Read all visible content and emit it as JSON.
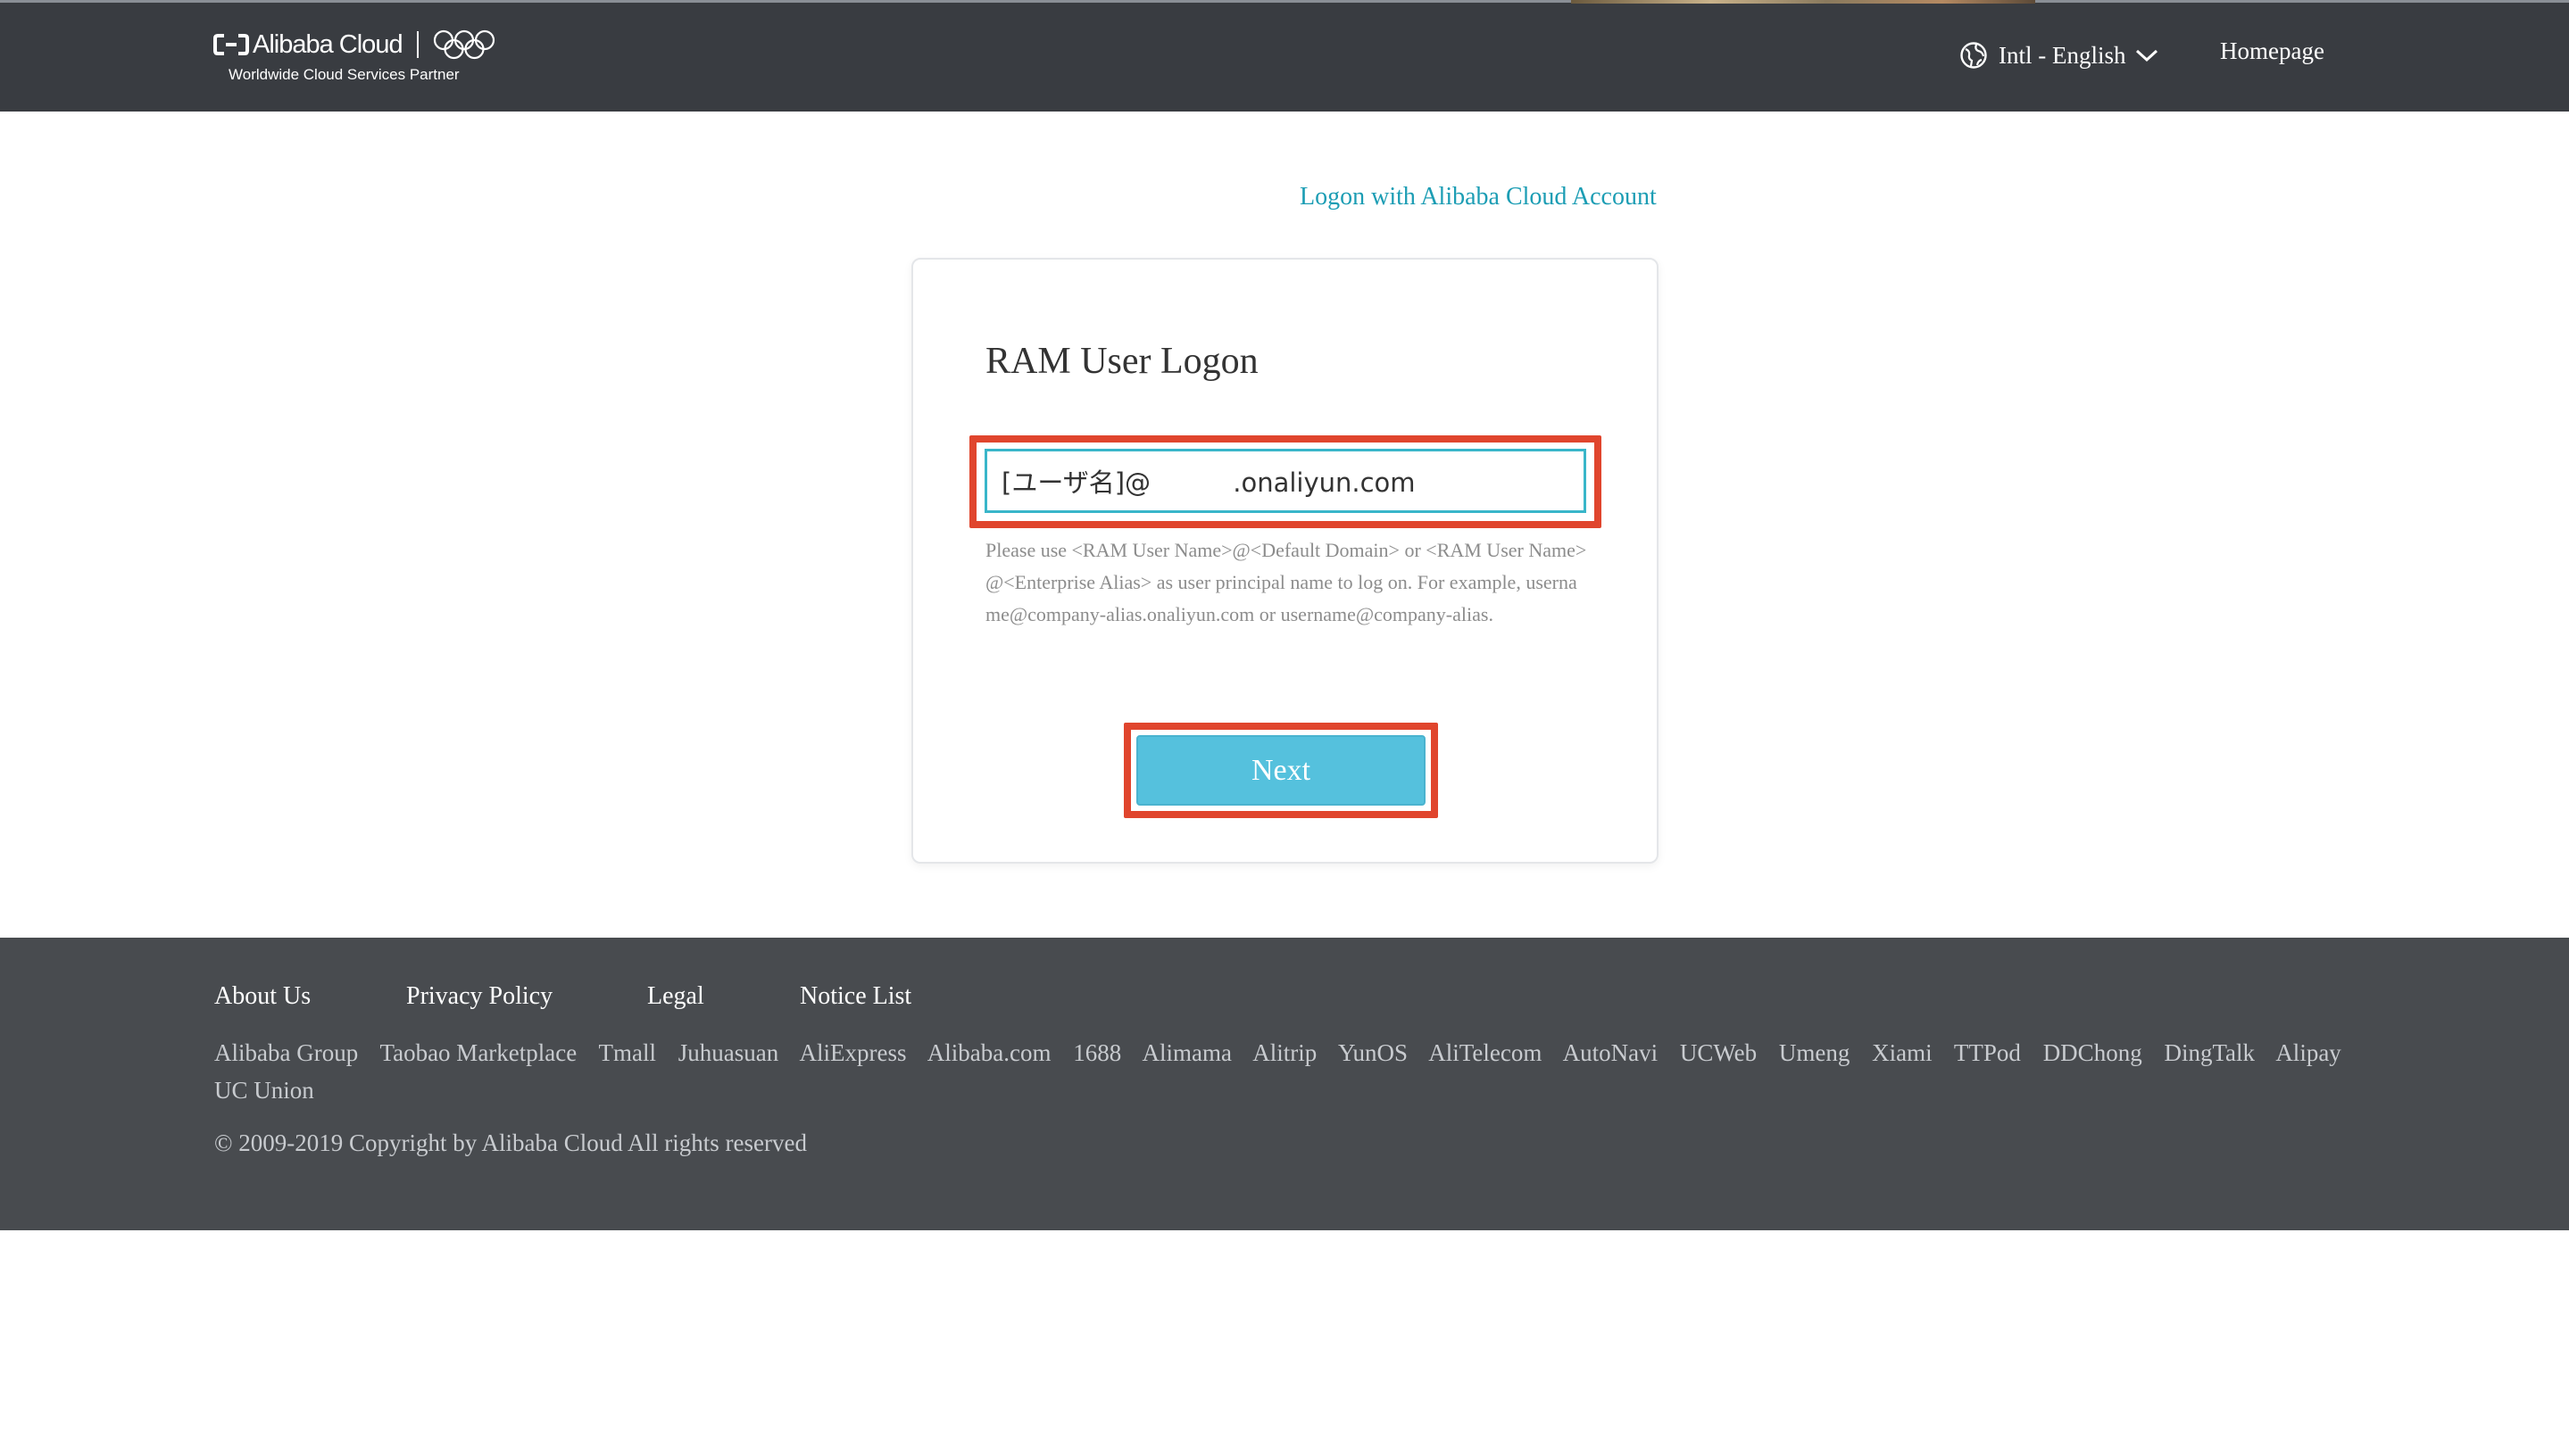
{
  "header": {
    "brand_name": "Alibaba Cloud",
    "tagline": "Worldwide Cloud Services Partner",
    "language": "Intl - English",
    "homepage_label": "Homepage"
  },
  "main": {
    "account_link": "Logon with Alibaba Cloud Account",
    "title": "RAM User Logon",
    "input_value": "[ユーザ名]@          .onaliyun.com",
    "help_text": "Please use <RAM User Name>@<Default Domain> or <RAM User Name>@<Enterprise Alias> as user principal name to log on. For example, username@company-alias.onaliyun.com or username@company-alias.",
    "next_label": "Next"
  },
  "footer": {
    "nav": [
      "About Us",
      "Privacy Policy",
      "Legal",
      "Notice List"
    ],
    "brands": [
      "Alibaba Group",
      "Taobao Marketplace",
      "Tmall",
      "Juhuasuan",
      "AliExpress",
      "Alibaba.com",
      "1688",
      "Alimama",
      "Alitrip",
      "YunOS",
      "AliTelecom",
      "AutoNavi",
      "UCWeb",
      "Umeng",
      "Xiami",
      "TTPod",
      "DDChong",
      "DingTalk",
      "Alipay",
      "UC Union"
    ],
    "copyright": "© 2009-2019 Copyright by Alibaba Cloud All rights reserved"
  },
  "colors": {
    "header_bg": "#393c41",
    "footer_bg": "#484b4f",
    "link": "#1c9db4",
    "button": "#55c1dd",
    "highlight": "#e0452d"
  },
  "icons": [
    "alibaba-cloud-logo-icon",
    "olympic-rings-icon",
    "globe-icon",
    "chevron-down-icon"
  ]
}
